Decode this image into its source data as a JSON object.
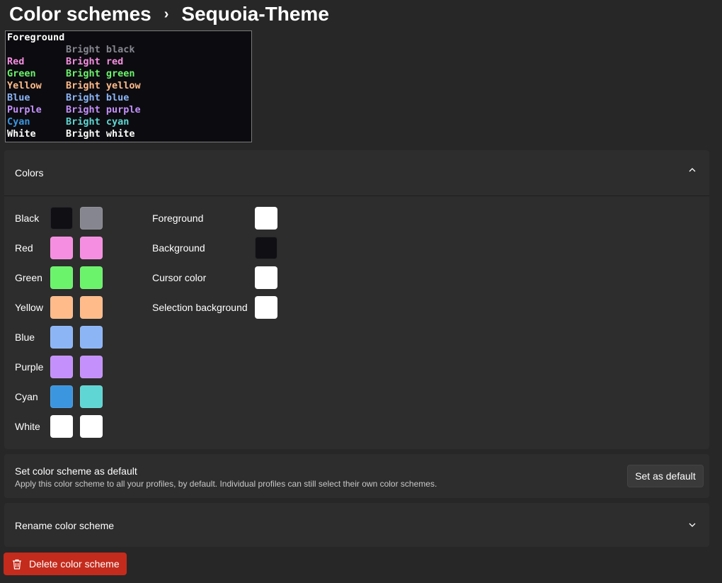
{
  "breadcrumb": {
    "parent": "Color schemes",
    "separator": "›",
    "current": "Sequoia-Theme"
  },
  "preview": {
    "background": "#0c0c10",
    "rows": [
      {
        "left": "Foreground",
        "left_color": "#ffffff",
        "right": "",
        "right_color": "#ffffff"
      },
      {
        "left": "",
        "left_color": "#ffffff",
        "right": "Bright black",
        "right_color": "#868690"
      },
      {
        "left": "Red",
        "left_color": "#f58ee0",
        "right": "Bright red",
        "right_color": "#f58ee0"
      },
      {
        "left": "Green",
        "left_color": "#6bf36b",
        "right": "Bright green",
        "right_color": "#6bf36b"
      },
      {
        "left": "Yellow",
        "left_color": "#ffbb8a",
        "right": "Bright yellow",
        "right_color": "#ffbb8a"
      },
      {
        "left": "Blue",
        "left_color": "#8cb5f6",
        "right": "Bright blue",
        "right_color": "#8cb5f6"
      },
      {
        "left": "Purple",
        "left_color": "#c490fb",
        "right": "Bright purple",
        "right_color": "#c490fb"
      },
      {
        "left": "Cyan",
        "left_color": "#3b96df",
        "right": "Bright cyan",
        "right_color": "#5fd6d3"
      },
      {
        "left": "White",
        "left_color": "#ffffff",
        "right": "Bright white",
        "right_color": "#ffffff"
      }
    ]
  },
  "colors_section": {
    "title": "Colors",
    "palette": [
      {
        "label": "Black",
        "normal": "#101014",
        "bright": "#868690"
      },
      {
        "label": "Red",
        "normal": "#f58ee0",
        "bright": "#f58ee0"
      },
      {
        "label": "Green",
        "normal": "#6bf36b",
        "bright": "#6bf36b"
      },
      {
        "label": "Yellow",
        "normal": "#ffbb8a",
        "bright": "#ffbb8a"
      },
      {
        "label": "Blue",
        "normal": "#8cb5f6",
        "bright": "#8cb5f6"
      },
      {
        "label": "Purple",
        "normal": "#c490fb",
        "bright": "#c490fb"
      },
      {
        "label": "Cyan",
        "normal": "#3b96df",
        "bright": "#5fd6d3"
      },
      {
        "label": "White",
        "normal": "#ffffff",
        "bright": "#ffffff"
      }
    ],
    "system": [
      {
        "label": "Foreground",
        "color": "#ffffff"
      },
      {
        "label": "Background",
        "color": "#101014"
      },
      {
        "label": "Cursor color",
        "color": "#ffffff"
      },
      {
        "label": "Selection background",
        "color": "#ffffff"
      }
    ]
  },
  "default_section": {
    "title": "Set color scheme as default",
    "description": "Apply this color scheme to all your profiles, by default. Individual profiles can still select their own color schemes.",
    "button_label": "Set as default"
  },
  "rename_section": {
    "title": "Rename color scheme"
  },
  "delete_button": {
    "label": "Delete color scheme",
    "color": "#c42b1c"
  }
}
